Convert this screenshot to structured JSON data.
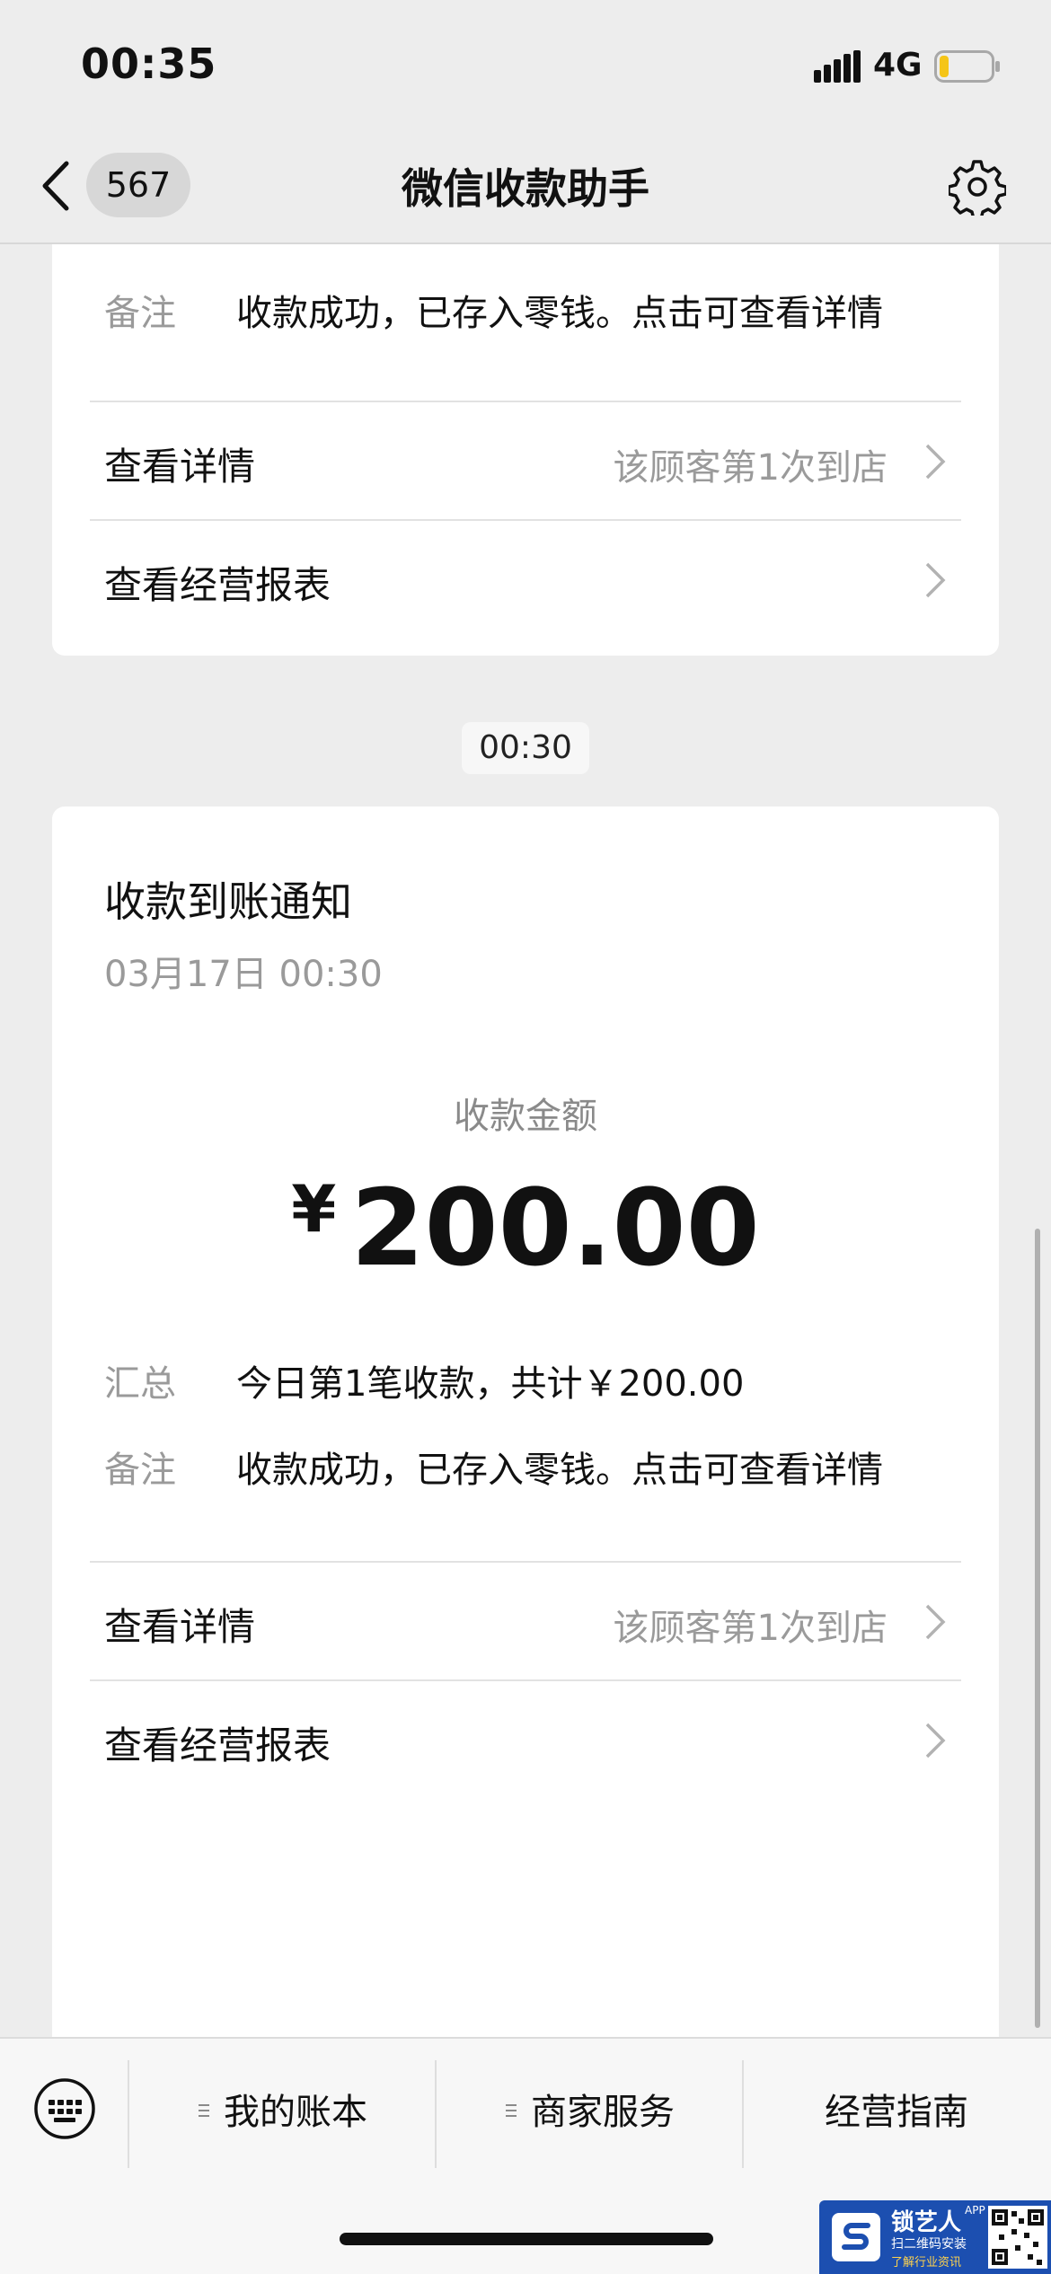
{
  "status_bar": {
    "time": "00:35",
    "network": "4G"
  },
  "nav": {
    "unread_count": "567",
    "title": "微信收款助手"
  },
  "previous_card": {
    "note_label": "备注",
    "note_value": "收款成功，已存入零钱。点击可查看详情",
    "detail_label": "查看详情",
    "detail_sub": "该顾客第1次到店",
    "report_label": "查看经营报表"
  },
  "timestamp": "00:30",
  "receipt_card": {
    "title": "收款到账通知",
    "date": "03月17日 00:30",
    "amount_label": "收款金额",
    "currency": "¥",
    "amount": "200.00",
    "summary_label": "汇总",
    "summary_value": "今日第1笔收款，共计￥200.00",
    "note_label": "备注",
    "note_value": "收款成功，已存入零钱。点击可查看详情",
    "detail_label": "查看详情",
    "detail_sub": "该顾客第1次到店",
    "report_label": "查看经营报表"
  },
  "menu": {
    "items": [
      "我的账本",
      "商家服务",
      "经营指南"
    ]
  },
  "watermark": {
    "name": "锁艺人",
    "app": "APP",
    "line1": "扫二维码安装",
    "line2": "了解行业资讯"
  },
  "colors": {
    "background": "#ededed",
    "card": "#ffffff",
    "muted_text": "#9a9a9a",
    "battery_level": "#f5c518"
  },
  "battery_level": 0.15
}
